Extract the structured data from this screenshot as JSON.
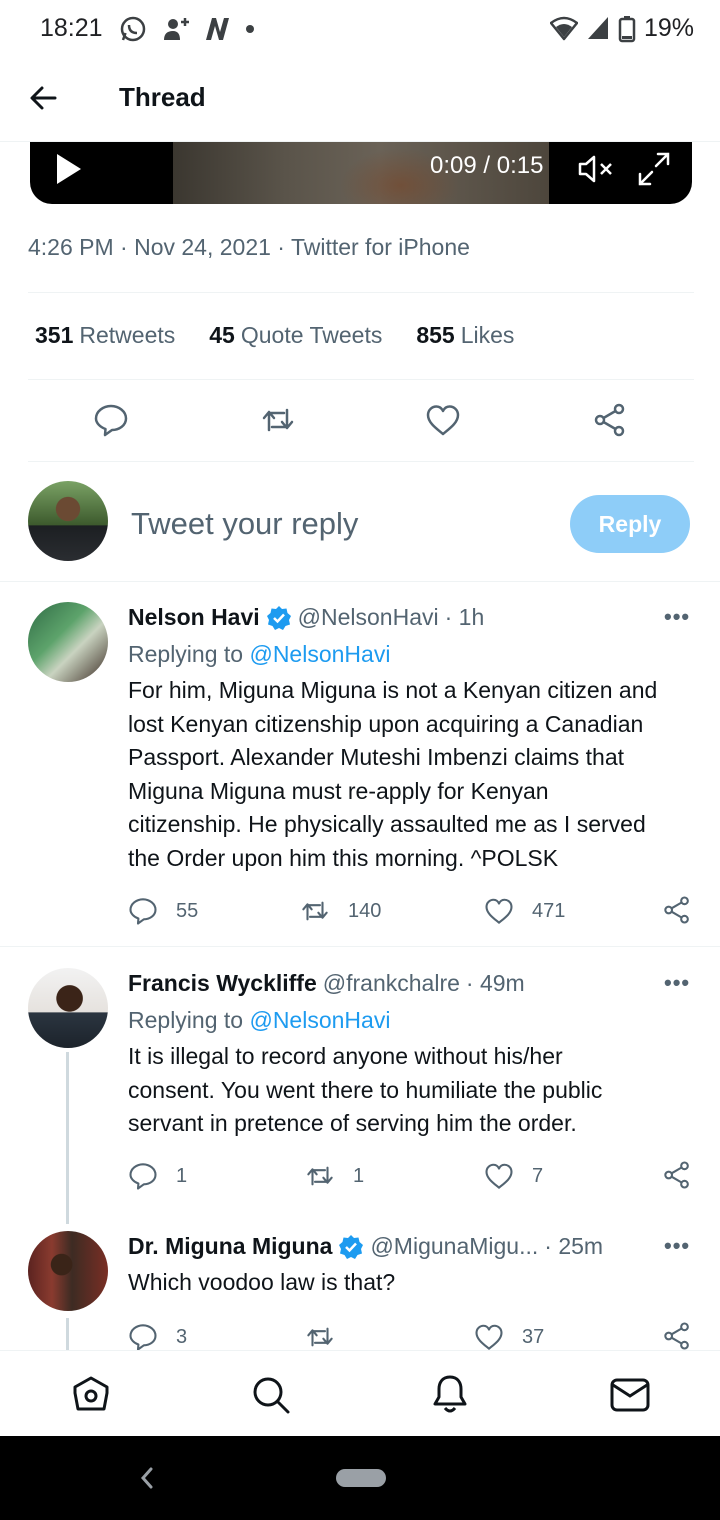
{
  "status_bar": {
    "time": "18:21",
    "battery": "19%"
  },
  "header": {
    "title": "Thread"
  },
  "video": {
    "time": "0:09 / 0:15"
  },
  "tweet": {
    "timestamp": "4:26 PM · Nov 24, 2021 · Twitter for iPhone",
    "retweets_count": "351",
    "retweets_label": "Retweets",
    "quotes_count": "45",
    "quotes_label": "Quote Tweets",
    "likes_count": "855",
    "likes_label": "Likes"
  },
  "composer": {
    "placeholder": "Tweet your reply",
    "reply_label": "Reply"
  },
  "replies": [
    {
      "name": "Nelson Havi",
      "verified": true,
      "handle": "@NelsonHavi",
      "time": "· 1h",
      "replying_prefix": "Replying to",
      "replying_to": "@NelsonHavi",
      "lines": [
        "For him, Miguna Miguna is not a Kenyan citizen and",
        "lost Kenyan citizenship upon acquiring a Canadian",
        "Passport. Alexander Muteshi Imbenzi claims that",
        "Miguna Miguna must re-apply for Kenyan",
        "citizenship. He physically assaulted me as I served",
        "the Order upon him this morning. ^POLSK"
      ],
      "replies": "55",
      "retweets": "140",
      "likes": "471"
    },
    {
      "name": "Francis Wyckliffe",
      "verified": false,
      "handle": "@frankchalre",
      "time": "· 49m",
      "replying_prefix": "Replying to",
      "replying_to": "@NelsonHavi",
      "lines": [
        "It is illegal to record anyone without his/her",
        "consent. You went there to humiliate the public",
        "servant in pretence of serving him the order."
      ],
      "replies": "1",
      "retweets": "1",
      "likes": "7"
    },
    {
      "name": "Dr. Miguna Miguna",
      "verified": true,
      "handle": "@MigunaMigu...",
      "time": "· 25m",
      "lines": [
        "Which voodoo law is that?"
      ],
      "replies": "3",
      "retweets": "",
      "likes": "37"
    }
  ],
  "colors": {
    "accent": "#1d9bf0",
    "muted": "#536471",
    "reply_button": "#8ecdf8"
  },
  "icons": {
    "nav": [
      "home-icon",
      "search-icon",
      "notifications-icon",
      "messages-icon"
    ],
    "actions": [
      "reply-icon",
      "retweet-icon",
      "like-icon",
      "share-icon"
    ]
  }
}
